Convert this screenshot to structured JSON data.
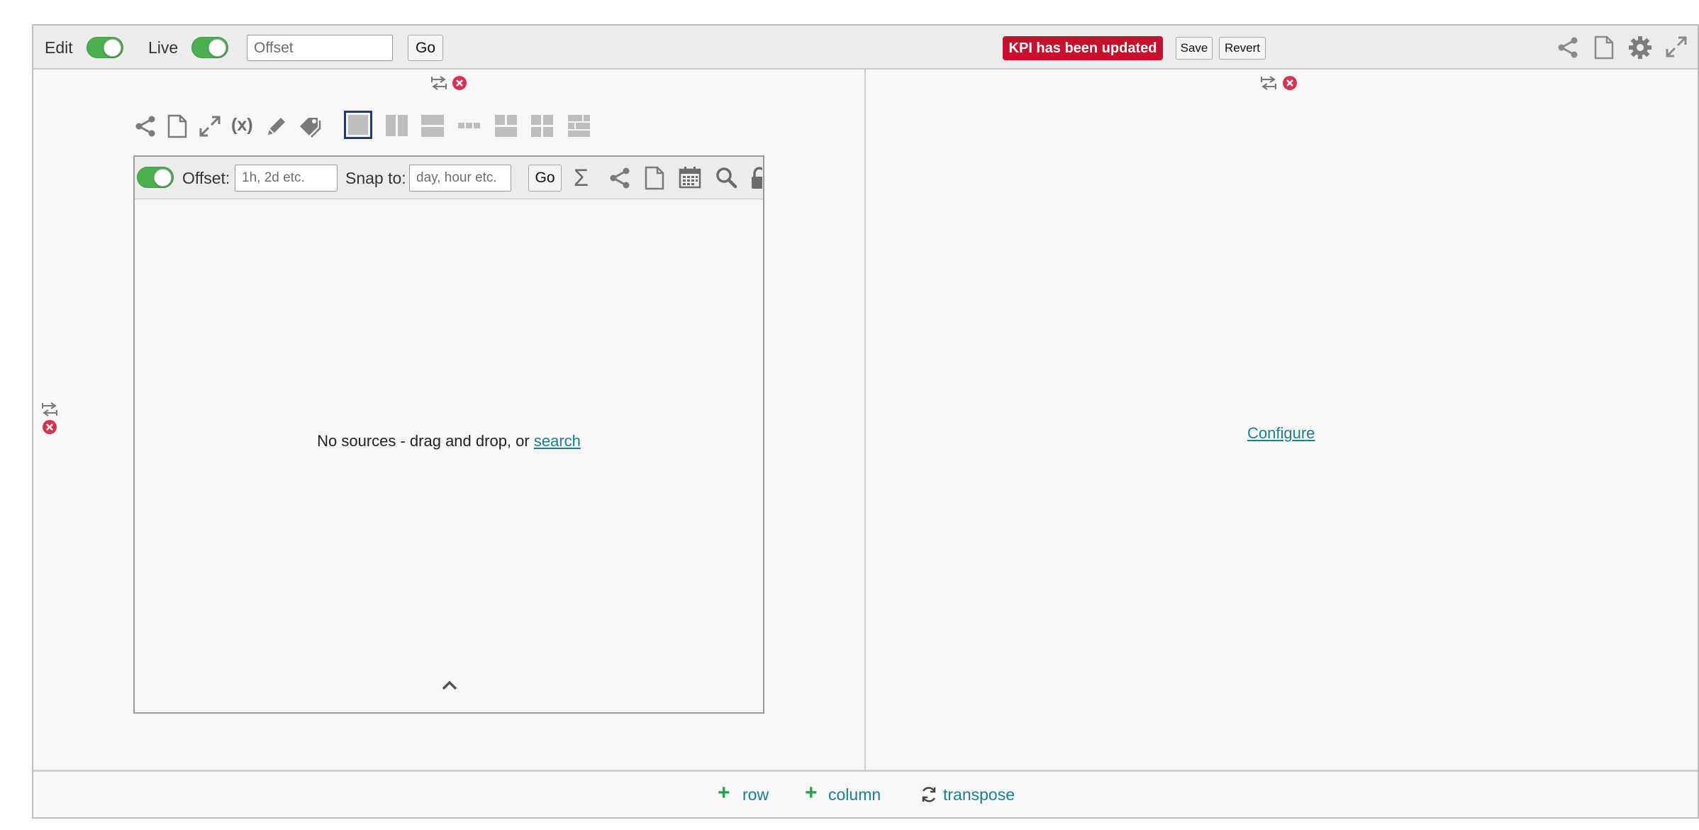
{
  "toolbar": {
    "edit_label": "Edit",
    "live_label": "Live",
    "offset_placeholder": "Offset",
    "go_label": "Go",
    "kpi_badge": "KPI has been updated",
    "save_label": "Save",
    "revert_label": "Revert",
    "right_icons": [
      "share-icon",
      "document-icon",
      "gear-icon",
      "expand-icon"
    ]
  },
  "left_panel": {
    "widget_icons": [
      "share-icon",
      "document-icon",
      "expand-icon",
      "variable-icon",
      "pencil-icon",
      "tag-icon"
    ],
    "layout_options": [
      "single",
      "two-columns",
      "two-rows",
      "row-of-cells",
      "two-by-two",
      "four-grid",
      "mixed"
    ],
    "selected_layout": "single",
    "widget": {
      "offset_label": "Offset:",
      "offset_placeholder": "1h, 2d etc.",
      "snap_label": "Snap to:",
      "snap_placeholder": "day, hour etc.",
      "go_label": "Go",
      "bar_icons": [
        "sigma-icon",
        "share-icon",
        "document-icon",
        "calendar-icon",
        "search-icon",
        "lock-icon"
      ],
      "empty_text": "No sources - drag and drop, or",
      "search_link": "search"
    }
  },
  "right_panel": {
    "configure_link": "Configure"
  },
  "footer": {
    "row_label": "row",
    "column_label": "column",
    "transpose_label": "transpose"
  },
  "colors": {
    "accent_green": "#4caf50",
    "badge_red": "#c8102e",
    "link_teal": "#1a7f8e",
    "close_red": "#d7334f",
    "selected_border": "#1f3c78"
  }
}
